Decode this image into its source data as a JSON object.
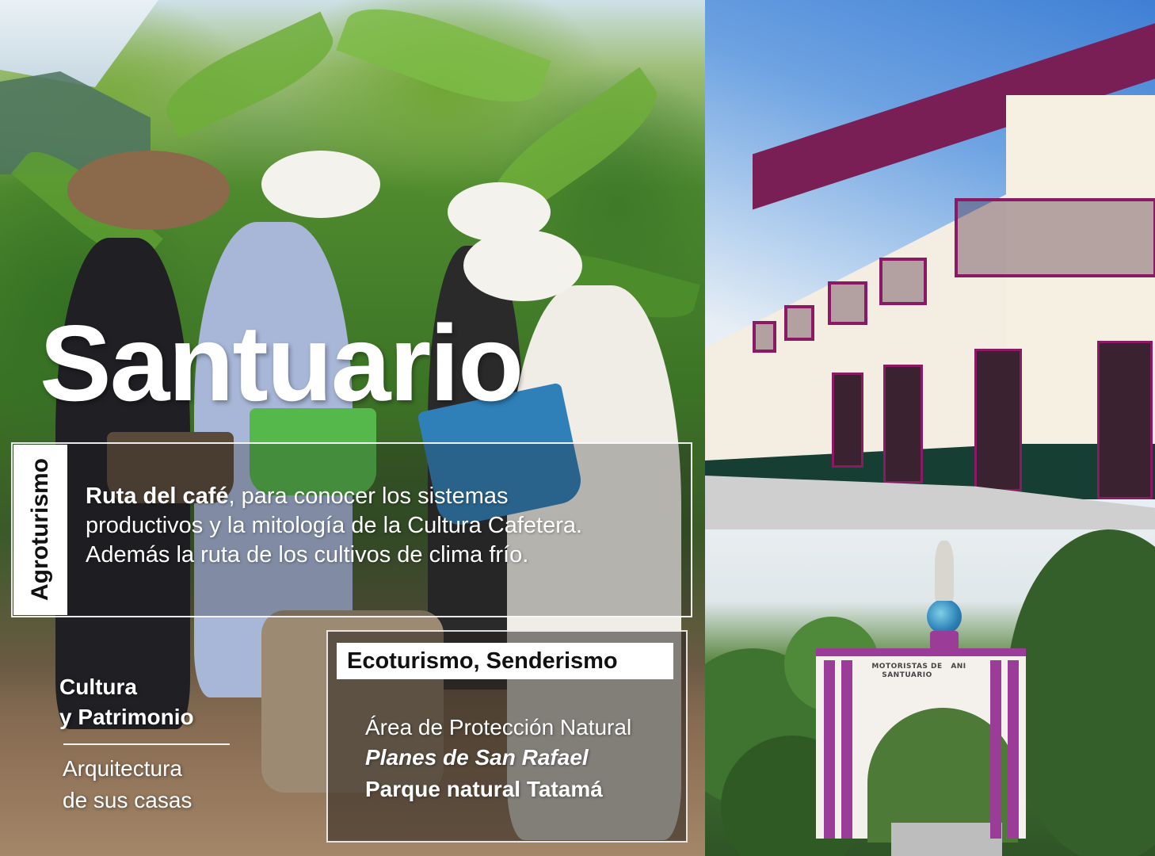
{
  "title": "Santuario",
  "agroturismo": {
    "tab_label": "Agroturismo",
    "highlight": "Ruta del café",
    "text_line_1": ", para conocer los sistemas",
    "text_line_2": "productivos y la mitología de la Cultura Cafetera.",
    "text_line_3": "Además la ruta de los cultivos de clima frío."
  },
  "ecoturismo": {
    "header": "Ecoturismo, Senderismo",
    "line_1": "Área de Protección Natural",
    "line_2": "Planes de San Rafael",
    "line_3": "Parque natural Tatamá"
  },
  "cultura": {
    "heading_line_1": "Cultura",
    "heading_line_2": "y Patrimonio",
    "sub_line_1": "Arquitectura",
    "sub_line_2": "de sus casas"
  },
  "arch_sign": {
    "line_1": "MOTORISTAS DE",
    "line_2": "SANTUARIO",
    "line_3": "ANI"
  },
  "colors": {
    "building_trim": "#8a1a63",
    "arch_columns": "#9b3d98",
    "overlay_white": "#ffffff"
  }
}
